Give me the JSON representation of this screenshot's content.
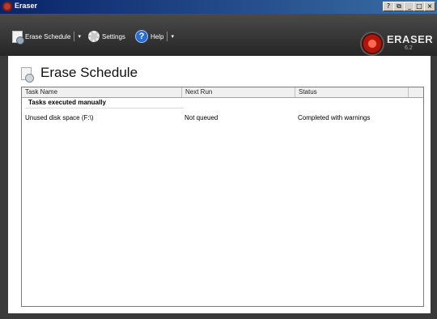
{
  "window": {
    "title": "Eraser",
    "controls": {
      "help": "?",
      "restore": "⧉",
      "minimize": "_",
      "maximize": "□",
      "close": "×"
    }
  },
  "toolbar": {
    "erase_schedule": "Erase Schedule",
    "settings": "Settings",
    "help": "Help",
    "dropdown_glyph": "▾"
  },
  "logo": {
    "name": "ERASER",
    "version": "6.2"
  },
  "page": {
    "title": "Erase Schedule"
  },
  "list": {
    "columns": [
      "Task Name",
      "Next Run",
      "Status"
    ],
    "group": "Tasks executed manually",
    "rows": [
      {
        "task": "Unused disk space (F:\\)",
        "next_run": "Not queued",
        "status": "Completed with warnings"
      }
    ]
  },
  "colors": {
    "accent": "#b0150c",
    "chrome": "#3a3a3a",
    "title_bar": "#0a246a"
  },
  "icons": [
    "app-icon",
    "erase-schedule-icon",
    "settings-gear-icon",
    "help-icon",
    "eraser-logo-icon",
    "schedule-page-icon"
  ]
}
